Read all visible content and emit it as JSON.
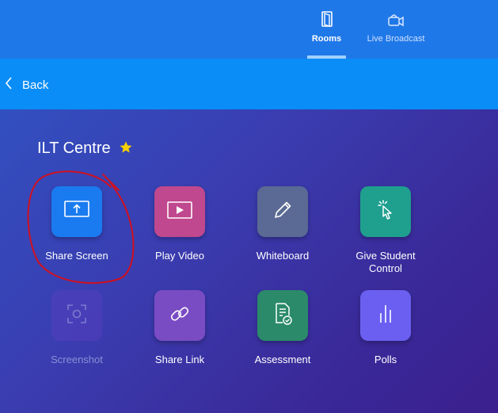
{
  "nav": {
    "tabs": [
      {
        "label": "Rooms",
        "icon": "door-icon",
        "active": true
      },
      {
        "label": "Live Broadcast",
        "icon": "video-camera-icon",
        "active": false
      }
    ]
  },
  "back": {
    "label": "Back",
    "icon": "chevron-left-icon"
  },
  "page": {
    "title": "ILT Centre",
    "star_icon": "star-icon",
    "star_color": "#f5d000"
  },
  "tools": [
    {
      "label": "Share Screen",
      "icon": "share-screen-icon",
      "color": "#1a7bf0",
      "enabled": true
    },
    {
      "label": "Play Video",
      "icon": "play-video-icon",
      "color": "#c0488e",
      "enabled": true
    },
    {
      "label": "Whiteboard",
      "icon": "pencil-icon",
      "color": "#5a6a94",
      "enabled": true
    },
    {
      "label": "Give Student Control",
      "icon": "pointer-click-icon",
      "color": "#1f9f8e",
      "enabled": true
    },
    {
      "label": "Screenshot",
      "icon": "screenshot-icon",
      "color": "#4a4fbd",
      "enabled": false
    },
    {
      "label": "Share Link",
      "icon": "link-icon",
      "color": "#7a4cc4",
      "enabled": true
    },
    {
      "label": "Assessment",
      "icon": "assessment-icon",
      "color": "#2b8a6a",
      "enabled": true
    },
    {
      "label": "Polls",
      "icon": "bar-chart-icon",
      "color": "#6a5ff0",
      "enabled": true
    }
  ],
  "annotation_color": "#d01020"
}
